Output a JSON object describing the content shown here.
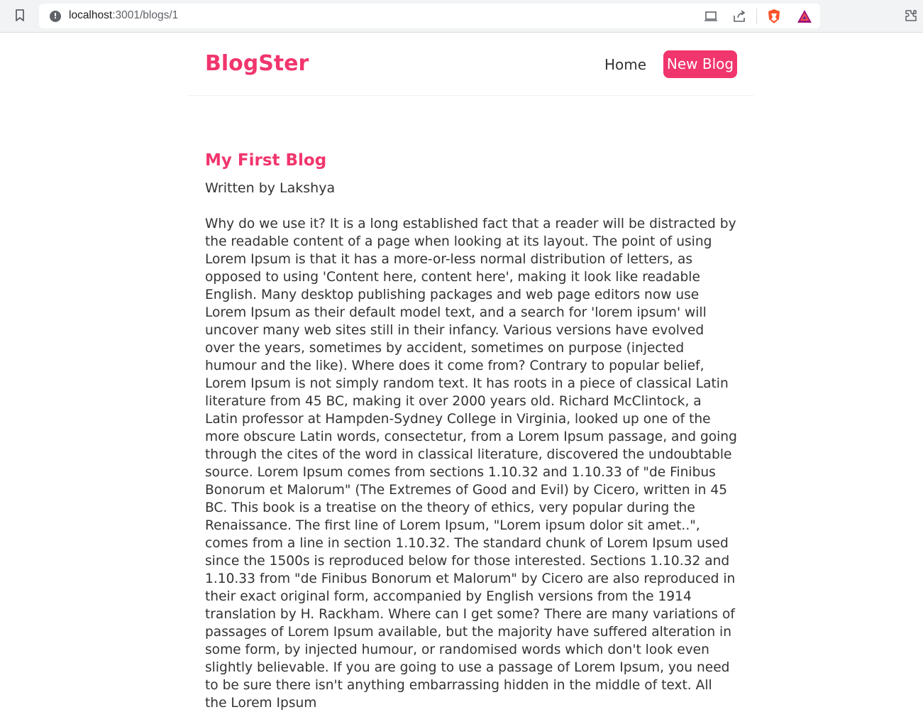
{
  "browser": {
    "url_host": "localhost",
    "url_rest": ":3001/blogs/1",
    "icons": [
      "bookmark-icon",
      "site-info-icon",
      "cast-icon",
      "share-icon",
      "brave-shields-icon",
      "brave-rewards-icon",
      "extensions-icon"
    ]
  },
  "site": {
    "brand": "BlogSter",
    "nav": {
      "home_label": "Home",
      "new_blog_label": "New Blog"
    },
    "accent_color": "#f1356d"
  },
  "blog": {
    "title": "My First Blog",
    "author_line": "Written by Lakshya",
    "body": "Why do we use it? It is a long established fact that a reader will be distracted by the readable content of a page when looking at its layout. The point of using Lorem Ipsum is that it has a more-or-less normal distribution of letters, as opposed to using 'Content here, content here', making it look like readable English. Many desktop publishing packages and web page editors now use Lorem Ipsum as their default model text, and a search for 'lorem ipsum' will uncover many web sites still in their infancy. Various versions have evolved over the years, sometimes by accident, sometimes on purpose (injected humour and the like). Where does it come from? Contrary to popular belief, Lorem Ipsum is not simply random text. It has roots in a piece of classical Latin literature from 45 BC, making it over 2000 years old. Richard McClintock, a Latin professor at Hampden-Sydney College in Virginia, looked up one of the more obscure Latin words, consectetur, from a Lorem Ipsum passage, and going through the cites of the word in classical literature, discovered the undoubtable source. Lorem Ipsum comes from sections 1.10.32 and 1.10.33 of \"de Finibus Bonorum et Malorum\" (The Extremes of Good and Evil) by Cicero, written in 45 BC. This book is a treatise on the theory of ethics, very popular during the Renaissance. The first line of Lorem Ipsum, \"Lorem ipsum dolor sit amet..\", comes from a line in section 1.10.32. The standard chunk of Lorem Ipsum used since the 1500s is reproduced below for those interested. Sections 1.10.32 and 1.10.33 from \"de Finibus Bonorum et Malorum\" by Cicero are also reproduced in their exact original form, accompanied by English versions from the 1914 translation by H. Rackham. Where can I get some? There are many variations of passages of Lorem Ipsum available, but the majority have suffered alteration in some form, by injected humour, or randomised words which don't look even slightly believable. If you are going to use a passage of Lorem Ipsum, you need to be sure there isn't anything embarrassing hidden in the middle of text. All the Lorem Ipsum"
  }
}
